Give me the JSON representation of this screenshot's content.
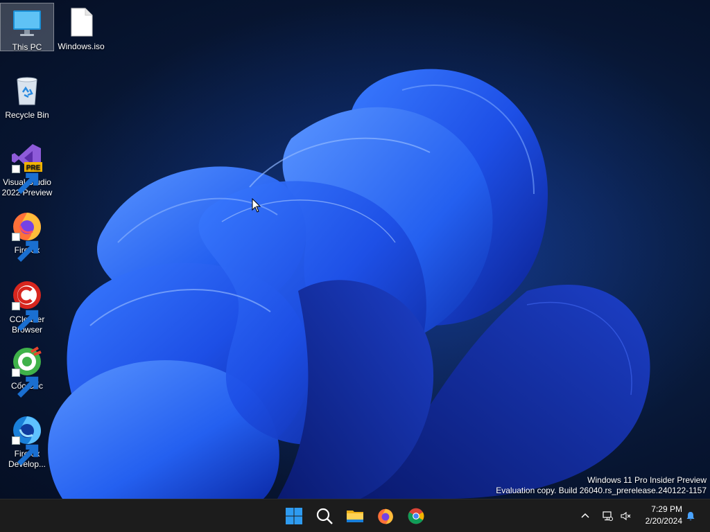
{
  "desktop": {
    "icons": [
      {
        "label": "This PC",
        "icon": "monitor-icon",
        "selected": true
      },
      {
        "label": "Windows.iso",
        "icon": "file-icon"
      },
      {
        "label": "Recycle Bin",
        "icon": "recycle-bin-icon"
      },
      {
        "label": "Visual Studio 2022 Preview",
        "icon": "visual-studio-preview-icon",
        "badge": "PRE"
      },
      {
        "label": "Firefox",
        "icon": "firefox-icon"
      },
      {
        "label": "CCleaner Browser",
        "icon": "ccleaner-browser-icon"
      },
      {
        "label": "Cốc Cốc",
        "icon": "coccoc-icon"
      },
      {
        "label": "Firefox Develop...",
        "icon": "firefox-developer-icon"
      }
    ],
    "watermark": {
      "line1": "Windows 11 Pro Insider Preview",
      "line2": "Evaluation copy. Build 26040.rs_prerelease.240122-1157"
    }
  },
  "taskbar": {
    "apps": [
      {
        "name": "Start",
        "icon": "windows-start-icon"
      },
      {
        "name": "Search",
        "icon": "search-icon"
      },
      {
        "name": "File Explorer",
        "icon": "folder-icon"
      },
      {
        "name": "Firefox",
        "icon": "firefox-icon"
      },
      {
        "name": "Google Chrome",
        "icon": "chrome-icon"
      }
    ],
    "tray": {
      "icons": [
        "chevron-up-icon",
        "network-icon",
        "speaker-muted-icon",
        "notification-bell-icon"
      ],
      "time": "7:29 PM",
      "date": "2/20/2024"
    }
  },
  "colors": {
    "taskbar_bg": "#1c1c1c",
    "wallpaper_blue": "#1f54e0",
    "accent": "#0078d4"
  }
}
